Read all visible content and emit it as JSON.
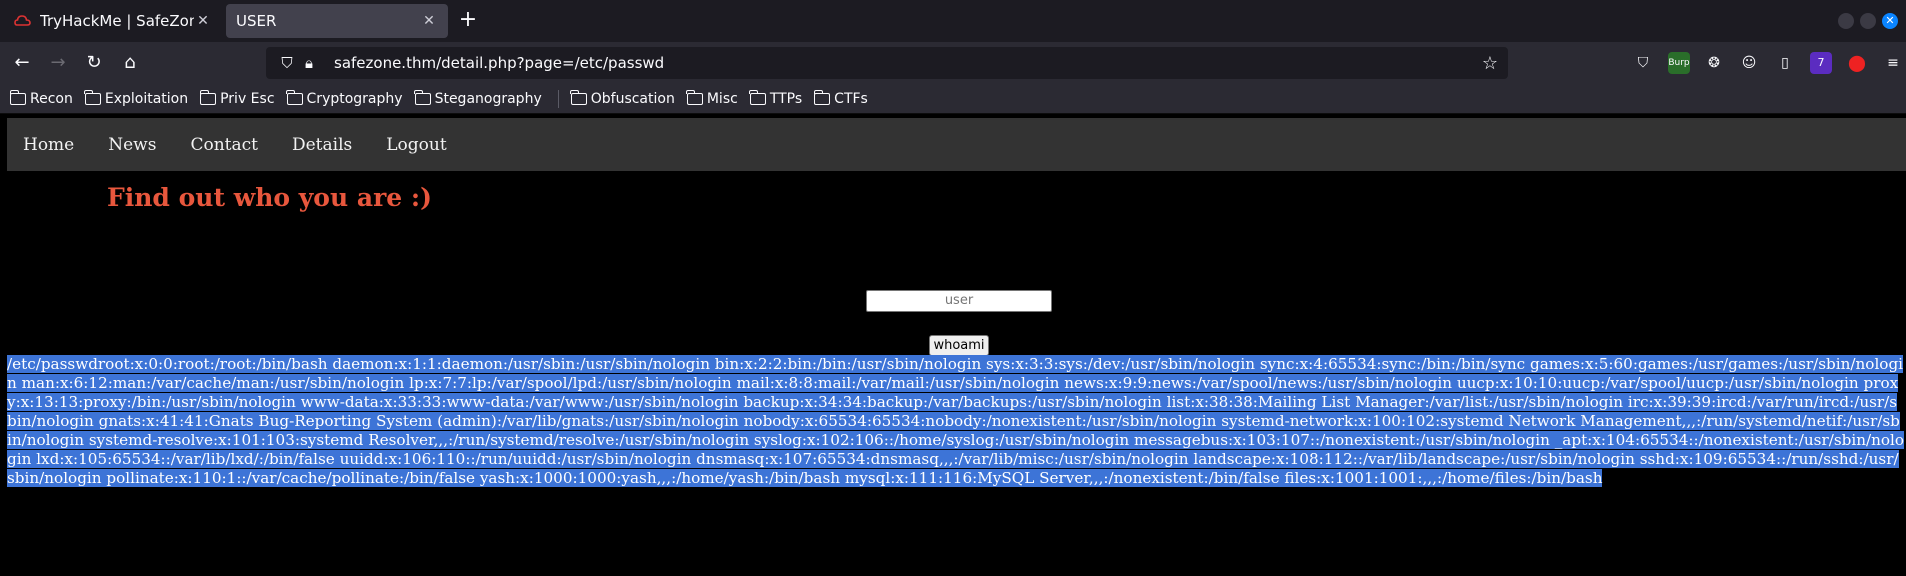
{
  "browser": {
    "tabs": [
      {
        "title": "TryHackMe | SafeZone",
        "active": false
      },
      {
        "title": "USER",
        "active": true
      }
    ],
    "url": "safezone.thm/detail.php?page=/etc/passwd",
    "bookmarks": [
      "Recon",
      "Exploitation",
      "Priv Esc",
      "Cryptography",
      "Steganography",
      "Obfuscation",
      "Misc",
      "TTPs",
      "CTFs"
    ],
    "extension_badges": {
      "burp": "Burp",
      "count": "7"
    }
  },
  "site": {
    "nav": [
      "Home",
      "News",
      "Contact",
      "Details",
      "Logout"
    ],
    "headline": "Find out who you are :)",
    "user_placeholder": "user",
    "button_label": "whoami",
    "output": "/etc/passwdroot:x:0:0:root:/root:/bin/bash daemon:x:1:1:daemon:/usr/sbin:/usr/sbin/nologin bin:x:2:2:bin:/bin:/usr/sbin/nologin sys:x:3:3:sys:/dev:/usr/sbin/nologin sync:x:4:65534:sync:/bin:/bin/sync games:x:5:60:games:/usr/games:/usr/sbin/nologin man:x:6:12:man:/var/cache/man:/usr/sbin/nologin lp:x:7:7:lp:/var/spool/lpd:/usr/sbin/nologin mail:x:8:8:mail:/var/mail:/usr/sbin/nologin news:x:9:9:news:/var/spool/news:/usr/sbin/nologin uucp:x:10:10:uucp:/var/spool/uucp:/usr/sbin/nologin proxy:x:13:13:proxy:/bin:/usr/sbin/nologin www-data:x:33:33:www-data:/var/www:/usr/sbin/nologin backup:x:34:34:backup:/var/backups:/usr/sbin/nologin list:x:38:38:Mailing List Manager:/var/list:/usr/sbin/nologin irc:x:39:39:ircd:/var/run/ircd:/usr/sbin/nologin gnats:x:41:41:Gnats Bug-Reporting System (admin):/var/lib/gnats:/usr/sbin/nologin nobody:x:65534:65534:nobody:/nonexistent:/usr/sbin/nologin systemd-network:x:100:102:systemd Network Management,,,:/run/systemd/netif:/usr/sbin/nologin systemd-resolve:x:101:103:systemd Resolver,,,:/run/systemd/resolve:/usr/sbin/nologin syslog:x:102:106::/home/syslog:/usr/sbin/nologin messagebus:x:103:107::/nonexistent:/usr/sbin/nologin _apt:x:104:65534::/nonexistent:/usr/sbin/nologin lxd:x:105:65534::/var/lib/lxd/:/bin/false uuidd:x:106:110::/run/uuidd:/usr/sbin/nologin dnsmasq:x:107:65534:dnsmasq,,,:/var/lib/misc:/usr/sbin/nologin landscape:x:108:112::/var/lib/landscape:/usr/sbin/nologin sshd:x:109:65534::/run/sshd:/usr/sbin/nologin pollinate:x:110:1::/var/cache/pollinate:/bin/false yash:x:1000:1000:yash,,,:/home/yash:/bin/bash mysql:x:111:116:MySQL Server,,,:/nonexistent:/bin/false files:x:1001:1001:,,,:/home/files:/bin/bash"
  },
  "colors": {
    "headline": "#e8573d",
    "selection": "#3d74d7",
    "sitenav_bg": "#333333"
  }
}
